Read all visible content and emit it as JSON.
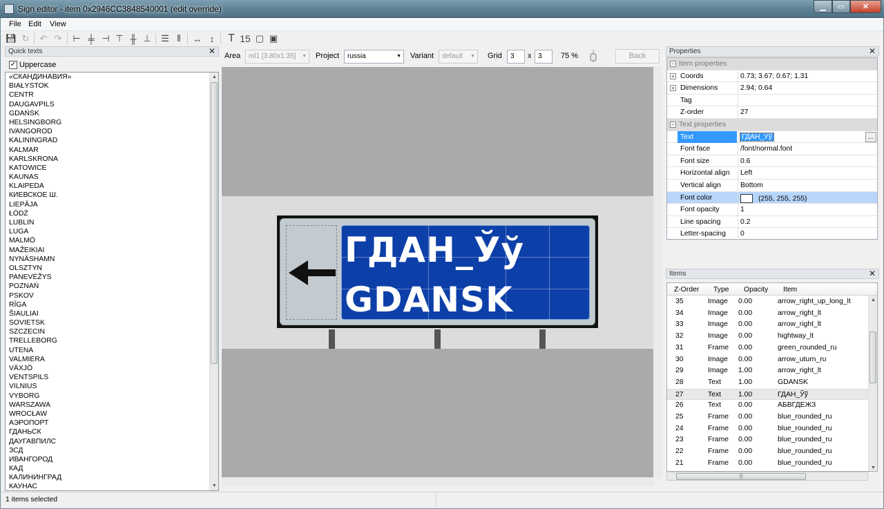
{
  "window": {
    "title": "Sign editor - item 0x2946CC3848540001 (edit override)"
  },
  "menu": [
    "File",
    "Edit",
    "View"
  ],
  "quick_texts": {
    "title": "Quick texts",
    "uppercase_label": "Uppercase",
    "uppercase_checked": true,
    "items": [
      "«СКАНДИНАВИЯ»",
      "BIAŁYSTOK",
      "CENTR",
      "DAUGAVPILS",
      "GDAŃSK",
      "HELSINGBORG",
      "IVANGOROD",
      "KALININGRAD",
      "KALMAR",
      "KARLSKRONA",
      "KATOWICE",
      "KAUNAS",
      "KLAIPEDA",
      "КИЕВСКОЕ Ш.",
      "LIEPĀJA",
      "ŁÓDŹ",
      "LUBLIN",
      "LUGA",
      "MALMÖ",
      "MAŽEIKIAI",
      "NYNÄSHAMN",
      "OLSZTYN",
      "PANEVĖŽYS",
      "POZNAŃ",
      "PSKOV",
      "RĪGA",
      "ŠIAULIAI",
      "SOVIETSK",
      "SZCZECIN",
      "TRELLEBORG",
      "UTENA",
      "VALMIERA",
      "VÄXJÖ",
      "VENTSPILS",
      "VILNIUS",
      "VYBORG",
      "WARSZAWA",
      "WROCŁAW",
      "АЭРОПОРТ",
      "ГДАНЬСК",
      "ДАУГАВПИЛС",
      "ЗСД",
      "ИВАНГОРОД",
      "КАД",
      "КАЛИНИНГРАД",
      "КАУНАС"
    ]
  },
  "controls": {
    "area_label": "Area",
    "area_value": "ml1 [3.80x1.35]",
    "project_label": "Project",
    "project_value": "russia",
    "variant_label": "Variant",
    "variant_value": "default",
    "grid_label": "Grid",
    "grid_x": "3",
    "grid_sep": "x",
    "grid_y": "3",
    "zoom": "75 %",
    "back_label": "Back"
  },
  "sign": {
    "line1": "ГДАН_Ўў",
    "line2": "GDANSK"
  },
  "properties": {
    "title": "Properties",
    "item_section": "Item properties",
    "coords_label": "Coords",
    "coords_value": "0.73; 3.67; 0.67; 1.31",
    "dims_label": "Dimensions",
    "dims_value": "2.94; 0.64",
    "tag_label": "Tag",
    "tag_value": "",
    "zorder_label": "Z-order",
    "zorder_value": "27",
    "text_section": "Text properties",
    "text_label": "Text",
    "text_value": "ГДАН_Ўў",
    "face_label": "Font face",
    "face_value": "/font/normal.font",
    "size_label": "Font size",
    "size_value": "0.6",
    "halign_label": "Horizontal align",
    "halign_value": "Left",
    "valign_label": "Vertical align",
    "valign_value": "Bottom",
    "color_label": "Font color",
    "color_value": "(255, 255, 255)",
    "opacity_label": "Font opacity",
    "opacity_value": "1",
    "spacing_label": "Line spacing",
    "spacing_value": "0.2",
    "letter_label": "Letter-spacing",
    "letter_value": "0"
  },
  "items": {
    "title": "Items",
    "headers": {
      "zorder": "Z-Order",
      "type": "Type",
      "opacity": "Opacity",
      "item": "Item"
    },
    "rows": [
      {
        "z": "35",
        "type": "Image",
        "opacity": "0.00",
        "item": "arrow_right_up_long_lt"
      },
      {
        "z": "34",
        "type": "Image",
        "opacity": "0.00",
        "item": "arrow_right_lt"
      },
      {
        "z": "33",
        "type": "Image",
        "opacity": "0.00",
        "item": "arrow_right_lt"
      },
      {
        "z": "32",
        "type": "Image",
        "opacity": "0.00",
        "item": "hightway_lt"
      },
      {
        "z": "31",
        "type": "Frame",
        "opacity": "0.00",
        "item": "green_rounded_ru"
      },
      {
        "z": "30",
        "type": "Image",
        "opacity": "0.00",
        "item": "arrow_uturn_ru"
      },
      {
        "z": "29",
        "type": "Image",
        "opacity": "1.00",
        "item": "arrow_right_lt"
      },
      {
        "z": "28",
        "type": "Text",
        "opacity": "1.00",
        "item": "GDANSK"
      },
      {
        "z": "27",
        "type": "Text",
        "opacity": "1.00",
        "item": "ГДАН_Ўў"
      },
      {
        "z": "26",
        "type": "Text",
        "opacity": "0.00",
        "item": "АБВГДЕЖЗ"
      },
      {
        "z": "25",
        "type": "Frame",
        "opacity": "0.00",
        "item": "blue_rounded_ru"
      },
      {
        "z": "24",
        "type": "Frame",
        "opacity": "0.00",
        "item": "blue_rounded_ru"
      },
      {
        "z": "23",
        "type": "Frame",
        "opacity": "0.00",
        "item": "blue_rounded_ru"
      },
      {
        "z": "22",
        "type": "Frame",
        "opacity": "0.00",
        "item": "blue_rounded_ru"
      },
      {
        "z": "21",
        "type": "Frame",
        "opacity": "0.00",
        "item": "blue_rounded_ru"
      }
    ],
    "selected_z": "27"
  },
  "status": {
    "text": "1 items selected"
  },
  "icons": [
    "save-icon",
    "reload-icon",
    "undo-icon",
    "redo-icon",
    "align-left-icon",
    "align-hcenter-icon",
    "align-right-icon",
    "align-top-icon",
    "align-vcenter-icon",
    "align-bottom-icon",
    "distribute-h-icon",
    "distribute-v-icon",
    "width-icon",
    "height-icon",
    "add-text-icon",
    "add-number-icon",
    "add-frame-icon",
    "add-image-icon"
  ]
}
